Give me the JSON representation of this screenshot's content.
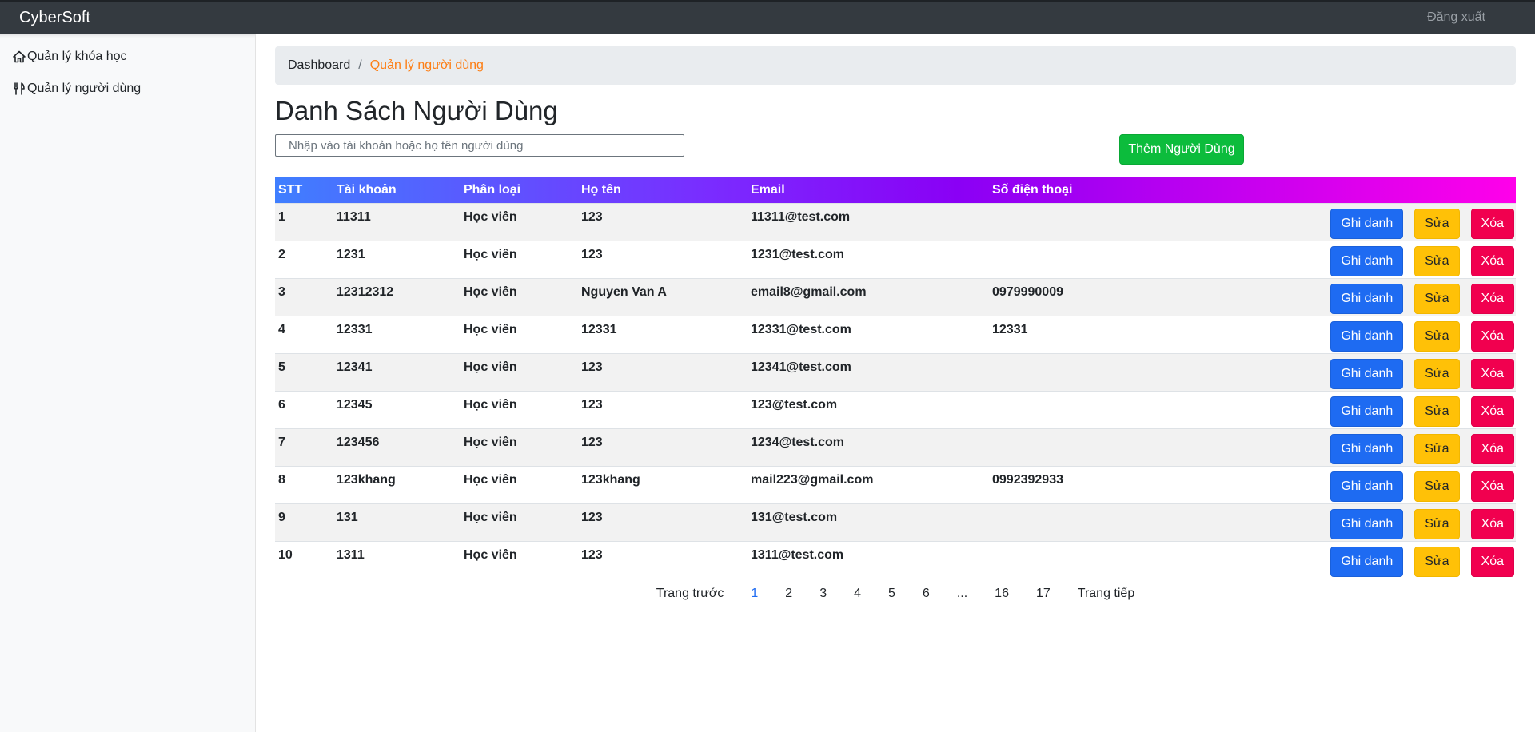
{
  "navbar": {
    "brand": "CyberSoft",
    "logout": "Đăng xuất"
  },
  "sidebar": {
    "items": [
      {
        "label": "Quản lý khóa học",
        "icon": "home-icon"
      },
      {
        "label": "Quản lý người dùng",
        "icon": "utensils-icon"
      }
    ]
  },
  "breadcrumb": {
    "root": "Dashboard",
    "separator": "/",
    "current": "Quản lý người dùng"
  },
  "page": {
    "title": "Danh Sách Người Dùng",
    "search_placeholder": "Nhập vào tài khoản hoặc họ tên người dùng",
    "add_button": "Thêm Người Dùng"
  },
  "table": {
    "headers": [
      "STT",
      "Tài khoản",
      "Phân loại",
      "Họ tên",
      "Email",
      "Số điện thoại"
    ],
    "actions": {
      "enroll": "Ghi danh",
      "edit": "Sửa",
      "delete": "Xóa"
    },
    "rows": [
      [
        "1",
        "11311",
        "Học viên",
        "123",
        "11311@test.com",
        ""
      ],
      [
        "2",
        "1231",
        "Học viên",
        "123",
        "1231@test.com",
        ""
      ],
      [
        "3",
        "12312312",
        "Học viên",
        "Nguyen Van A",
        "email8@gmail.com",
        "0979990009"
      ],
      [
        "4",
        "12331",
        "Học viên",
        "12331",
        "12331@test.com",
        "12331"
      ],
      [
        "5",
        "12341",
        "Học viên",
        "123",
        "12341@test.com",
        ""
      ],
      [
        "6",
        "12345",
        "Học viên",
        "123",
        "123@test.com",
        ""
      ],
      [
        "7",
        "123456",
        "Học viên",
        "123",
        "1234@test.com",
        ""
      ],
      [
        "8",
        "123khang",
        "Học viên",
        "123khang",
        "mail223@gmail.com",
        "0992392933"
      ],
      [
        "9",
        "131",
        "Học viên",
        "123",
        "131@test.com",
        ""
      ],
      [
        "10",
        "1311",
        "Học viên",
        "123",
        "1311@test.com",
        ""
      ]
    ]
  },
  "pagination": {
    "prev": "Trang trước",
    "pages": [
      "1",
      "2",
      "3",
      "4",
      "5",
      "6",
      "...",
      "16",
      "17"
    ],
    "current": "1",
    "next": "Trang tiếp"
  },
  "colors": {
    "navbar": "#343a40",
    "add_button": "#0cbc3c",
    "enroll": "#1e6bf2",
    "edit": "#ffc107",
    "delete": "#f1004f",
    "breadcrumb_active": "#fd7e14"
  }
}
